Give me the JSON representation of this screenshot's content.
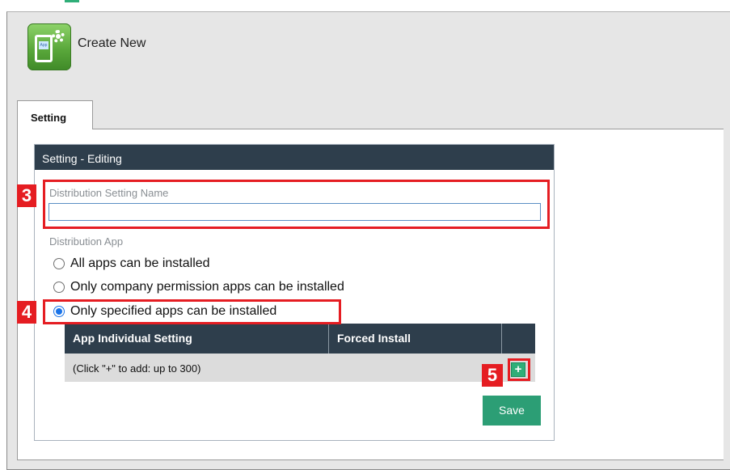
{
  "header": {
    "title": "Create New",
    "icon_label": "App"
  },
  "tabs": [
    {
      "label": "Setting",
      "active": true
    }
  ],
  "panel": {
    "title": "Setting - Editing",
    "name_field": {
      "label": "Distribution Setting Name",
      "value": ""
    },
    "distribution_app": {
      "label": "Distribution App",
      "options": [
        {
          "label": "All apps can be installed",
          "checked": false
        },
        {
          "label": "Only company permission apps can be installed",
          "checked": false
        },
        {
          "label": "Only specified apps can be installed",
          "checked": true
        }
      ]
    },
    "table": {
      "columns": [
        "App Individual Setting",
        "Forced Install",
        ""
      ],
      "empty_row_text": "(Click \"+\" to add: up to 300)",
      "add_label": "+"
    },
    "save_label": "Save"
  },
  "callouts": {
    "c3": "3",
    "c4": "4",
    "c5": "5"
  },
  "colors": {
    "header_bg": "#2e3e4c",
    "accent_green": "#2c9e75",
    "callout_red": "#e51d22",
    "radio_selected": "#1a73e8"
  }
}
